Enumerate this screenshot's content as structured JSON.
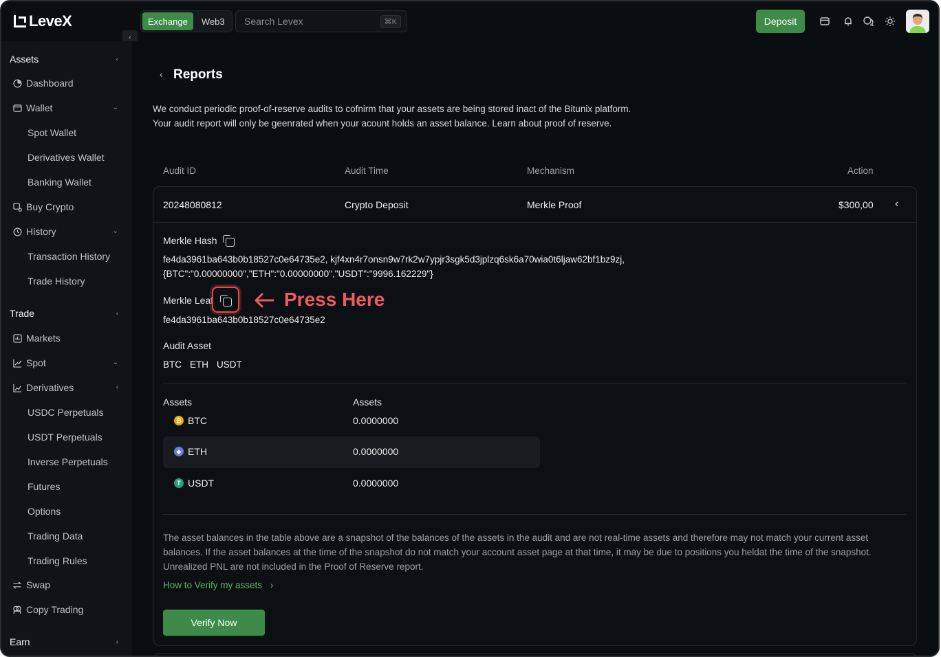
{
  "app": {
    "name": "LeveX"
  },
  "topbar": {
    "tabs": [
      {
        "label": "Exchange",
        "active": true
      },
      {
        "label": "Web3",
        "active": false
      }
    ],
    "search": {
      "placeholder": "Search Levex",
      "shortcut": "⌘K"
    },
    "deposit_label": "Deposit",
    "icons": [
      "wallet-icon",
      "bell-icon",
      "chat-icon",
      "sun-icon"
    ]
  },
  "sidebar": {
    "assets": {
      "title": "Assets",
      "dashboard": "Dashboard",
      "wallet": "Wallet",
      "spot_wallet": "Spot Wallet",
      "derivatives_wallet": "Derivatives Wallet",
      "banking_wallet": "Banking Wallet",
      "buy_crypto": "Buy Crypto",
      "history": "History",
      "transaction_history": "Transaction History",
      "trade_history": "Trade History"
    },
    "trade": {
      "title": "Trade",
      "markets": "Markets",
      "spot": "Spot",
      "derivatives": "Derivatives",
      "usdc_perpetuals": "USDC Perpetuals",
      "usdt_perpetuals": "USDT Perpetuals",
      "inverse_perpetuals": "Inverse Perpetuals",
      "futures": "Futures",
      "options": "Options",
      "trading_data": "Trading Data",
      "trading_rules": "Trading Rules",
      "swap": "Swap",
      "copy_trading": "Copy Trading"
    },
    "earn": {
      "title": "Earn"
    }
  },
  "page": {
    "title": "Reports",
    "intro_line1": "We conduct periodic proof-of-reserve audits to cofnirm that your assets are being stored inact of the Bitunix platform.",
    "intro_line2": "Your audit report will only be geenrated when your acount holds an asset balance. Learn about proof of reserve."
  },
  "table": {
    "headers": {
      "audit_id": "Audit ID",
      "audit_time": "Audit Time",
      "mechanism": "Mechanism",
      "action": "Action"
    },
    "row": {
      "audit_id": "20248080812",
      "audit_time": "Crypto Deposit",
      "mechanism": "Merkle Proof",
      "action": "$300,00"
    }
  },
  "details": {
    "merkle_hash_label": "Merkle Hash",
    "merkle_hash_line1": "fe4da3961ba643b0b18527c0e64735e2, kjf4xn4r7onsn9w7rk2w7ypjr3sgk5d3jplzq6sk6a70wia0t6ljaw62bf1bz9zj,",
    "merkle_hash_line2": "{BTC\":\"0.00000000\",\"ETH\":\"0.00000000\",\"USDT\":\"9996.162229\"}",
    "merkle_leaf_label": "Merkle Leaf",
    "merkle_leaf_value": "fe4da3961ba643b0b18527c0e64735e2",
    "annotation": "Press Here",
    "audit_asset_label": "Audit Asset",
    "audit_assets": [
      "BTC",
      "ETH",
      "USDT"
    ],
    "assets_header_1": "Assets",
    "assets_header_2": "Assets",
    "assets": [
      {
        "name": "BTC",
        "value": "0.0000000",
        "color": "#f2a900",
        "glyph": "₿"
      },
      {
        "name": "ETH",
        "value": "0.0000000",
        "color": "#627eea",
        "glyph": "◆"
      },
      {
        "name": "USDT",
        "value": "0.0000000",
        "color": "#26a17b",
        "glyph": "T"
      }
    ],
    "note": "The asset balances in the table above are a snapshot of the balances of the assets in the audit and are not real-time assets and therefore may not match your current asset balances. If the asset balances at the time of the snapshot do not match your account asset page at that time, it may be due to positions you heldat the time of the snapshot. Unrealized PNL are not included in the Proof of Reserve report.",
    "verify_link": "How to Verify my assets",
    "verify_button": "Verify Now"
  },
  "colors": {
    "accent": "#3e8b49",
    "annotation": "#ef5a62",
    "link": "#59b468"
  }
}
